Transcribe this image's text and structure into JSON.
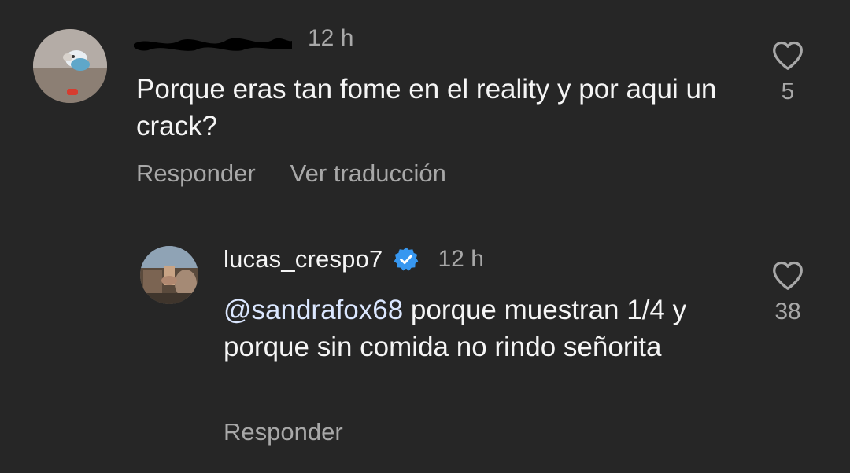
{
  "comment": {
    "time": "12 h",
    "text": "Porque eras tan fome en el reality y por aqui un crack?",
    "actions": {
      "reply": "Responder",
      "translate": "Ver traducción"
    },
    "like_count": "5"
  },
  "reply": {
    "username": "lucas_crespo7",
    "verified": true,
    "time": "12 h",
    "mention": "@sandrafox68",
    "text": " porque muestran 1/4 y porque sin comida no rindo señorita",
    "actions": {
      "reply": "Responder"
    },
    "like_count": "38"
  },
  "colors": {
    "background": "#262626",
    "text_primary": "#f5f5f5",
    "text_secondary": "#a8a8a8",
    "mention": "#dbe7ff",
    "verified": "#3797f0"
  },
  "icons": [
    "heart-outline-icon",
    "verified-badge-icon"
  ]
}
